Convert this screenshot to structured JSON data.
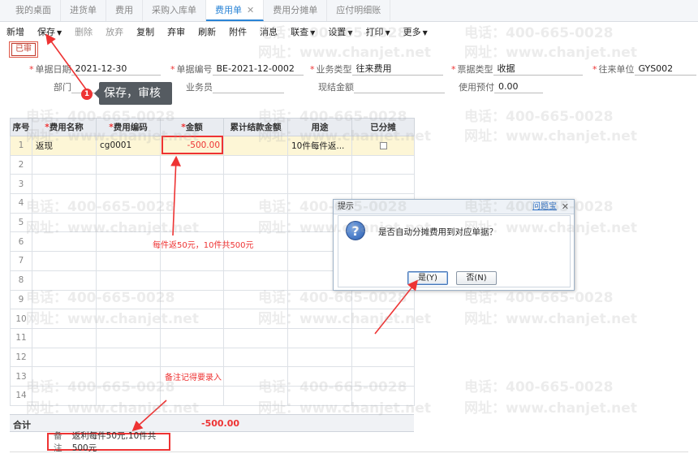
{
  "tabs": [
    {
      "label": "我的桌面",
      "active": false
    },
    {
      "label": "进货单",
      "active": false
    },
    {
      "label": "费用",
      "active": false
    },
    {
      "label": "采购入库单",
      "active": false
    },
    {
      "label": "费用单",
      "active": true,
      "close": "✕"
    },
    {
      "label": "费用分摊单",
      "active": false
    },
    {
      "label": "应付明细账",
      "active": false
    }
  ],
  "toolbar": {
    "new": "新增",
    "save": "保存",
    "delete": "删除",
    "abandon": "放弃",
    "copy": "复制",
    "unaudit": "弃审",
    "refresh": "刷新",
    "attach": "附件",
    "message": "消息",
    "link": "联查",
    "settings": "设置",
    "print": "打印",
    "more": "更多"
  },
  "status_badge": "已审",
  "form": {
    "date_label": "单据日期",
    "date_value": "2021-12-30",
    "code_label": "单据编号",
    "code_value": "BE-2021-12-0002",
    "biztype_label": "业务类型",
    "biztype_value": "往来费用",
    "billtype_label": "票据类型",
    "billtype_value": "收据",
    "partner_label": "往来单位",
    "partner_value": "GYS002",
    "dept_label": "部门",
    "dept_value": "",
    "clerk_label": "业务员",
    "clerk_value": "",
    "cash_label": "现结金额",
    "cash_value": "",
    "prepay_label": "使用预付",
    "prepay_value": "0.00"
  },
  "tooltip": {
    "step": "1",
    "text": "保存，审核"
  },
  "grid": {
    "headers": {
      "idx": "序号",
      "name": "费用名称",
      "code": "费用编码",
      "amount": "金额",
      "settled": "累计结款金额",
      "purpose": "用途",
      "allocated": "已分摊"
    },
    "rows": [
      {
        "idx": "1",
        "name": "返现",
        "code": "cg0001",
        "amount": "-500.00",
        "settled": "",
        "purpose": "10件每件返...",
        "allocated": false
      },
      {
        "idx": "2"
      },
      {
        "idx": "3"
      },
      {
        "idx": "4"
      },
      {
        "idx": "5"
      },
      {
        "idx": "6"
      },
      {
        "idx": "7"
      },
      {
        "idx": "8"
      },
      {
        "idx": "9"
      },
      {
        "idx": "10"
      },
      {
        "idx": "11"
      },
      {
        "idx": "12"
      },
      {
        "idx": "13"
      },
      {
        "idx": "14"
      }
    ],
    "total_label": "合计",
    "total_amount": "-500.00"
  },
  "remark": {
    "label": "备注",
    "value": "返利每件50元,10件共500元"
  },
  "notes": {
    "amount_note": "每件返50元，10件共500元",
    "remark_note": "备注记得要录入"
  },
  "dialog": {
    "title": "提示",
    "help": "问题宝",
    "close": "✕",
    "message": "是否自动分摊费用到对应单据？",
    "yes": "是(Y)",
    "no": "否(N)"
  },
  "watermark": {
    "phone": "电话：400-665-0028",
    "site": "网址：www.chanjet.net"
  },
  "colors": {
    "accent": "#2a84d6",
    "annotation": "#e33333",
    "selected_row": "#fdf6d6"
  }
}
